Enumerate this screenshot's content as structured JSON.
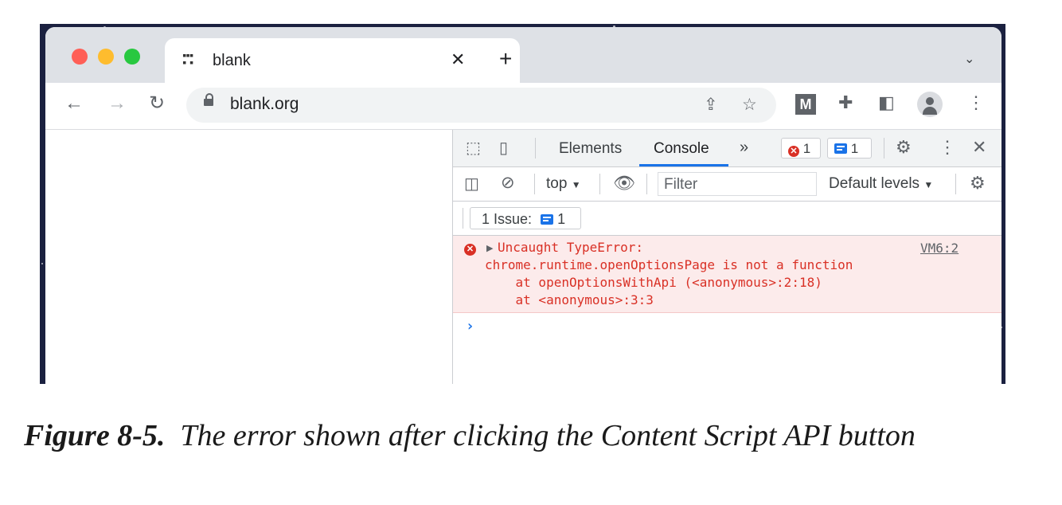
{
  "browser": {
    "tab": {
      "title": "blank",
      "close": "✕"
    },
    "new_tab": "+",
    "tab_menu": "⌄",
    "address": {
      "url": "blank.org"
    },
    "extension_label": "M",
    "colors": {
      "close": "#ff5f57",
      "minimize": "#febc2e",
      "maximize": "#28c840"
    }
  },
  "devtools": {
    "tabs": {
      "elements": "Elements",
      "console": "Console",
      "more": "»"
    },
    "badges": {
      "errors": "1",
      "messages": "1"
    },
    "console_toolbar": {
      "context": "top",
      "filter_placeholder": "Filter",
      "levels": "Default levels"
    },
    "issues": {
      "label": "1 Issue:",
      "count": "1"
    },
    "error": {
      "title": "Uncaught TypeError:",
      "line1": "chrome.runtime.openOptionsPage is not a function",
      "line2": "    at openOptionsWithApi (<anonymous>:2:18)",
      "line3": "    at <anonymous>:3:3",
      "source": "VM6:2"
    },
    "prompt": "›"
  },
  "caption": {
    "figure": "Figure 8-5.",
    "text": "The error shown after clicking the Content Script API button"
  }
}
